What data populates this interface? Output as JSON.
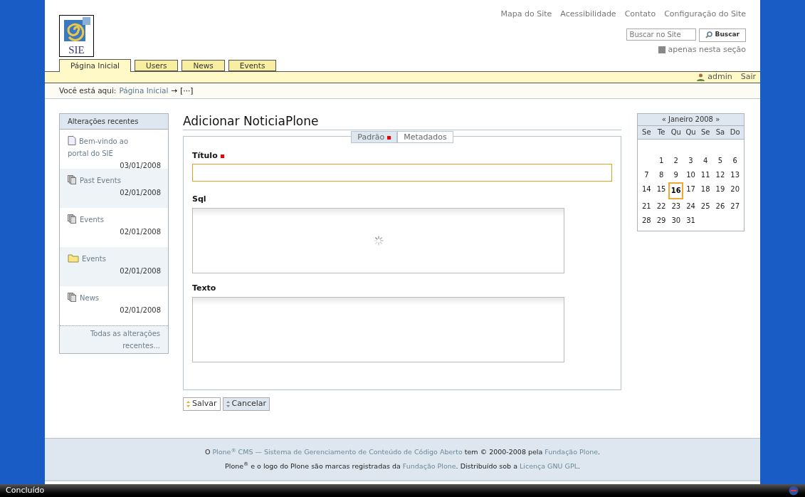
{
  "site_actions": [
    "Mapa do Site",
    "Acessibilidade",
    "Contato",
    "Configuração do Site"
  ],
  "search": {
    "placeholder": "Buscar no Site",
    "button": "Buscar",
    "scope_label": "apenas nesta seção",
    "scope_checked": true
  },
  "logo": {
    "text": "SIE"
  },
  "tabs": [
    {
      "label": "Página Inicial",
      "selected": true
    },
    {
      "label": "Users",
      "selected": false
    },
    {
      "label": "News",
      "selected": false
    },
    {
      "label": "Events",
      "selected": false
    }
  ],
  "personal_bar": {
    "user": "admin",
    "logout": "Sair"
  },
  "breadcrumb": {
    "label": "Você está aqui:",
    "items": [
      "Página Inicial",
      "[···]"
    ],
    "separator": "→"
  },
  "recent": {
    "title": "Alterações recentes",
    "items": [
      {
        "title": "Bem-vindo ao portal do SIE",
        "date": "03/01/2008",
        "kind": "document"
      },
      {
        "title": "Past Events",
        "date": "02/01/2008",
        "kind": "collection"
      },
      {
        "title": "Events",
        "date": "02/01/2008",
        "kind": "collection"
      },
      {
        "title": "Events",
        "date": "02/01/2008",
        "kind": "folder"
      },
      {
        "title": "News",
        "date": "02/01/2008",
        "kind": "collection"
      }
    ],
    "more": "Todas as alterações recentes..."
  },
  "form": {
    "title": "Adicionar NoticiaPlone",
    "fieldset_tabs": [
      {
        "label": "Padrão",
        "selected": true,
        "required": true
      },
      {
        "label": "Metadados",
        "selected": false,
        "required": false
      }
    ],
    "fields": [
      {
        "label": "Título",
        "required": true,
        "kind": "input",
        "focused": true
      },
      {
        "label": "Sql",
        "required": false,
        "kind": "textarea",
        "loading": true
      },
      {
        "label": "Texto",
        "required": false,
        "kind": "textarea",
        "loading": false
      }
    ],
    "buttons": [
      {
        "label": "Salvar",
        "kind": "primary"
      },
      {
        "label": "Cancelar",
        "kind": "secondary"
      }
    ]
  },
  "calendar": {
    "title": "« Janeiro 2008 »",
    "weekdays": [
      "Se",
      "Te",
      "Qu",
      "Qu",
      "Se",
      "Sa",
      "Do"
    ],
    "weeks": [
      [
        {
          "day": "1",
          "today": false
        },
        {
          "day": "2",
          "today": false
        },
        {
          "day": "3",
          "today": false
        },
        {
          "day": "4",
          "today": false
        },
        {
          "day": "5",
          "today": false
        },
        {
          "day": "6",
          "today": false
        }
      ],
      [
        {
          "day": "7",
          "today": false
        },
        {
          "day": "8",
          "today": false
        },
        {
          "day": "9",
          "today": false
        },
        {
          "day": "10",
          "today": false
        },
        {
          "day": "11",
          "today": false
        },
        {
          "day": "12",
          "today": false
        },
        {
          "day": "13",
          "today": false
        }
      ],
      [
        {
          "day": "14",
          "today": false
        },
        {
          "day": "15",
          "today": false
        },
        {
          "day": "16",
          "today": true
        },
        {
          "day": "17",
          "today": false
        },
        {
          "day": "18",
          "today": false
        },
        {
          "day": "19",
          "today": false
        },
        {
          "day": "20",
          "today": false
        }
      ],
      [
        {
          "day": "21",
          "today": false
        },
        {
          "day": "22",
          "today": false
        },
        {
          "day": "23",
          "today": false
        },
        {
          "day": "24",
          "today": false
        },
        {
          "day": "25",
          "today": false
        },
        {
          "day": "26",
          "today": false
        },
        {
          "day": "27",
          "today": false
        }
      ],
      [
        {
          "day": "28",
          "today": false
        },
        {
          "day": "29",
          "today": false
        },
        {
          "day": "30",
          "today": false
        },
        {
          "day": "31",
          "today": false
        }
      ]
    ]
  },
  "footer": [
    [
      {
        "text": "O ",
        "kind": "plain"
      },
      {
        "text": "Plone$^{®}$ CMS — Sistema de Gerenciamento de Conteúdo de Código Aberto",
        "kind": "link"
      },
      {
        "text": " tem © 2000-2008 pela ",
        "kind": "plain"
      },
      {
        "text": "Fundação Plone",
        "kind": "link"
      },
      {
        "text": ".",
        "kind": "plain"
      }
    ],
    [
      {
        "text": "Plone$^{®}$ e o logo do Plone são marcas registradas da ",
        "kind": "plain"
      },
      {
        "text": "Fundação Plone",
        "kind": "link"
      },
      {
        "text": ". Distribuído sob a ",
        "kind": "plain"
      },
      {
        "text": "Licença GNU GPL",
        "kind": "link"
      },
      {
        "text": ".",
        "kind": "plain"
      }
    ]
  ],
  "status_bar": {
    "text": "Concluído"
  }
}
